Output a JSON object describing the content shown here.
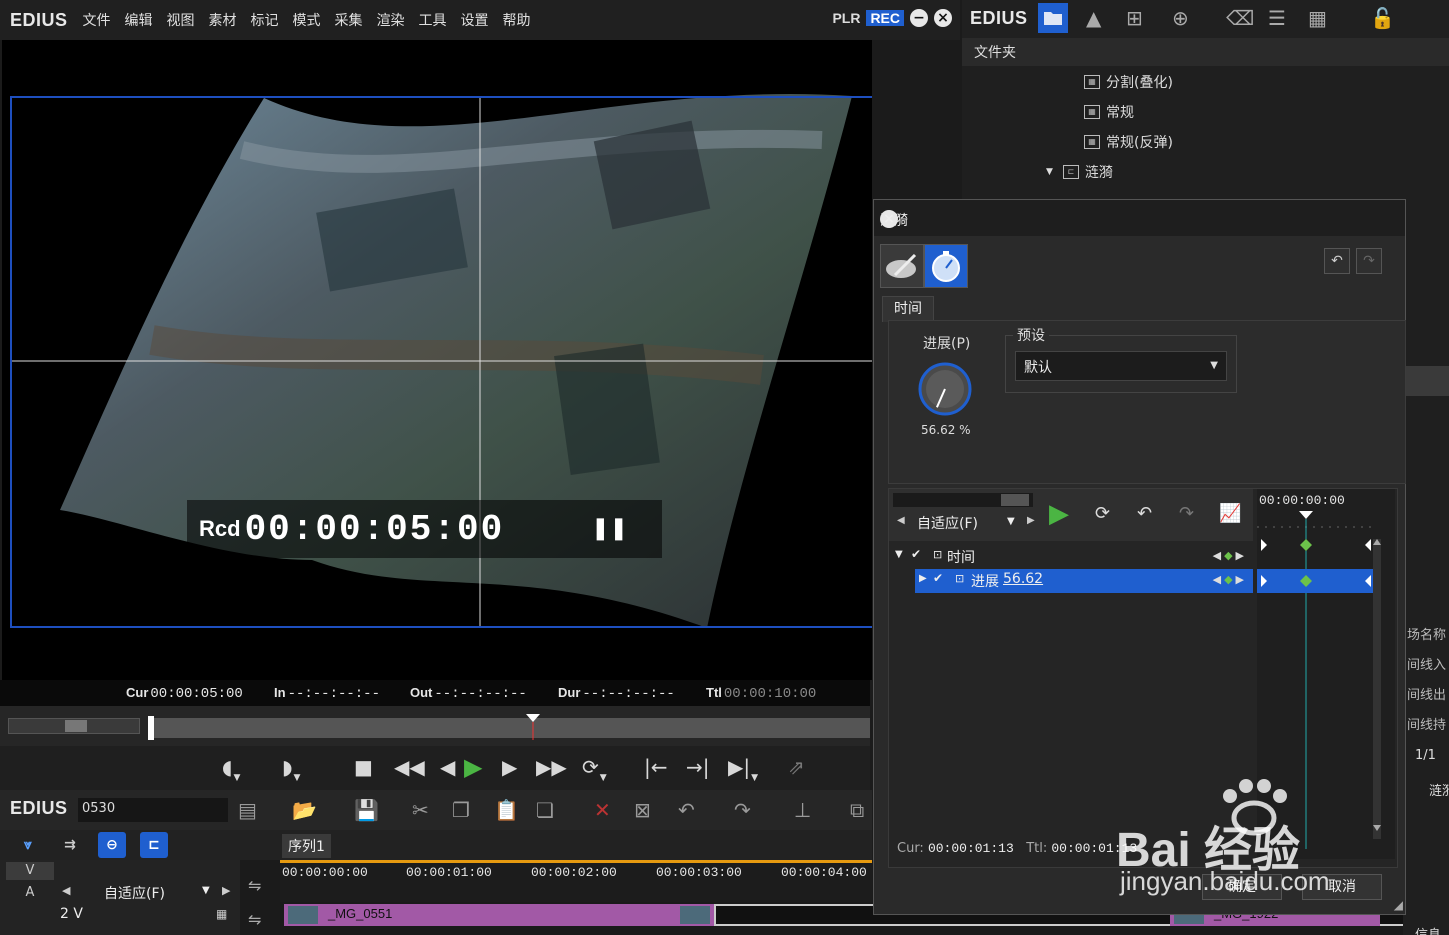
{
  "player": {
    "app_name": "EDIUS",
    "menu": [
      "文件",
      "编辑",
      "视图",
      "素材",
      "标记",
      "模式",
      "采集",
      "渲染",
      "工具",
      "设置",
      "帮助"
    ],
    "plr_label": "PLR",
    "rec_label": "REC",
    "overlay": {
      "rcd_label": "Rcd",
      "timecode": "00:00:05:00"
    },
    "timecodes": {
      "cur_label": "Cur",
      "cur_value": "00:00:05:00",
      "in_label": "In",
      "in_value": "--:--:--:--",
      "out_label": "Out",
      "out_value": "--:--:--:--",
      "dur_label": "Dur",
      "dur_value": "--:--:--:--",
      "ttl_label": "Ttl",
      "ttl_value": "00:00:10:00"
    }
  },
  "timeline": {
    "app_name": "EDIUS",
    "project_name": "0530",
    "sequence_tab": "序列1",
    "ruler": [
      "00:00:00:00",
      "00:00:01:00",
      "00:00:02:00",
      "00:00:03:00",
      "00:00:04:00"
    ],
    "track_v_label": "V",
    "track_a_label": "A",
    "fit_label": "自适应(F)",
    "track_name": "2 V",
    "clips": [
      "_MG_0551",
      "_MG_1922"
    ]
  },
  "bin": {
    "app_name": "EDIUS",
    "folder_header": "文件夹",
    "tree": [
      "分割(叠化)",
      "常规",
      "常规(反弹)",
      "涟漪"
    ],
    "partial": [
      "场名称",
      "间线入",
      "间线出",
      "间线持",
      "1/1",
      "涟漪",
      "信息"
    ]
  },
  "dialog": {
    "title": "涟漪",
    "time_tab": "时间",
    "progress_label": "进展(P)",
    "progress_value": "56.62 %",
    "progress_fraction": 0.5662,
    "preset_label": "预设",
    "preset_value": "默认",
    "kf_fit": "自适应(F)",
    "kf_tc": "00:00:00:00",
    "row_time": "时间",
    "row_progress_label": "进展",
    "row_progress_value": "56.62",
    "footer_cur_label": "Cur:",
    "footer_cur_value": "00:00:01:13",
    "footer_ttl_label": "Ttl:",
    "footer_ttl_value": "00:00:01:13",
    "ok_button": "确定",
    "cancel_button": "取消"
  },
  "watermark": {
    "brand": "Bai 经验",
    "sub": "jingyan.baidu.com"
  },
  "colors": {
    "accent": "#1f5fcf",
    "play_green": "#4bb543",
    "keyframe_green": "#6cc24a",
    "clip_purple": "#a259a6",
    "ruler_orange": "#e69a10"
  }
}
